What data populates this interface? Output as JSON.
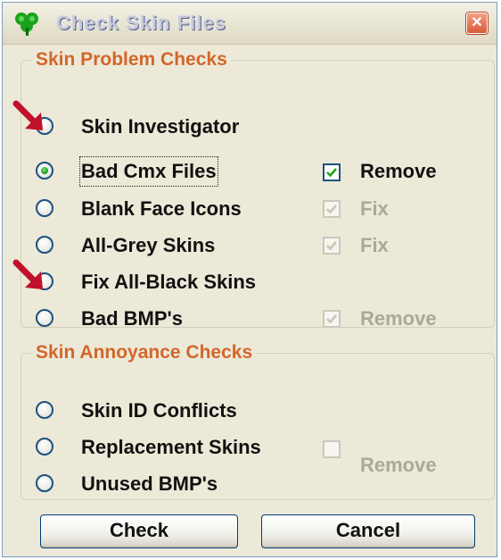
{
  "window": {
    "title": "Check Skin Files",
    "close_glyph": "✕",
    "icon": "green-clover-icon"
  },
  "problem_checks": {
    "legend": "Skin Problem Checks",
    "options": [
      {
        "label": "Skin Investigator",
        "selected": false
      },
      {
        "label": "Bad Cmx Files",
        "selected": true
      },
      {
        "label": "Blank Face Icons",
        "selected": false
      },
      {
        "label": "All-Grey Skins",
        "selected": false
      },
      {
        "label": "Fix All-Black Skins",
        "selected": false
      },
      {
        "label": "Bad BMP's",
        "selected": false
      }
    ],
    "checkboxes": {
      "bad_cmx_remove": {
        "label": "Remove",
        "checked": true,
        "enabled": true
      },
      "blank_face_fix": {
        "label": "Fix",
        "checked": true,
        "enabled": false
      },
      "all_grey_fix": {
        "label": "Fix",
        "checked": true,
        "enabled": false
      },
      "bad_bmp_remove": {
        "label": "Remove",
        "checked": true,
        "enabled": false
      }
    }
  },
  "annoyance_checks": {
    "legend": "Skin Annoyance Checks",
    "options": [
      {
        "label": "Skin ID Conflicts",
        "selected": false
      },
      {
        "label": "Replacement Skins",
        "selected": false
      },
      {
        "label": "Unused BMP's",
        "selected": false
      }
    ],
    "checkboxes": {
      "annoyance_remove": {
        "label": "Remove",
        "checked": false,
        "enabled": false
      }
    }
  },
  "buttons": {
    "check": "Check",
    "cancel": "Cancel"
  },
  "colors": {
    "legend": "#d4662a",
    "window_bg": "#ece9d8",
    "disabled_text": "#aca899",
    "annotation_arrow": "#c0102a"
  }
}
